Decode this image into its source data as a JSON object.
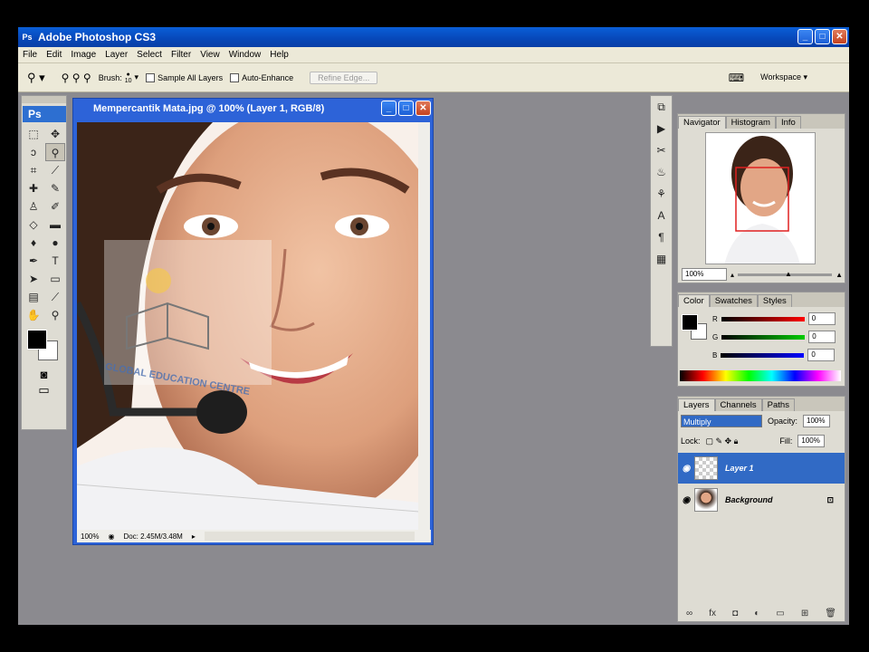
{
  "window": {
    "app_title": "Adobe Photoshop CS3",
    "ps_badge": "Ps"
  },
  "menu": [
    "File",
    "Edit",
    "Image",
    "Layer",
    "Select",
    "Filter",
    "View",
    "Window",
    "Help"
  ],
  "options": {
    "brush_label": "Brush:",
    "brush_size": "10",
    "sample_all_layers": "Sample All Layers",
    "auto_enhance": "Auto-Enhance",
    "refine_edge": "Refine Edge...",
    "workspace": "Workspace ▾"
  },
  "toolbox": {
    "badge": "Ps"
  },
  "document": {
    "title": "Mempercantik Mata.jpg @ 100% (Layer 1, RGB/8)",
    "zoom": "100%",
    "doc_size": "Doc: 2.45M/3.48M",
    "watermark": "GLOBAL EDUCATION CENTRE"
  },
  "navigator": {
    "tabs": [
      "Navigator",
      "Histogram",
      "Info"
    ],
    "zoom": "100%"
  },
  "color": {
    "tabs": [
      "Color",
      "Swatches",
      "Styles"
    ],
    "r_label": "R",
    "g_label": "G",
    "b_label": "B",
    "r": "0",
    "g": "0",
    "b": "0"
  },
  "layers": {
    "tabs": [
      "Layers",
      "Channels",
      "Paths"
    ],
    "blend_mode": "Multiply",
    "opacity_label": "Opacity:",
    "opacity": "100%",
    "lock_label": "Lock:",
    "fill_label": "Fill:",
    "fill": "100%",
    "items": [
      {
        "name": "Layer 1"
      },
      {
        "name": "Background"
      }
    ]
  }
}
